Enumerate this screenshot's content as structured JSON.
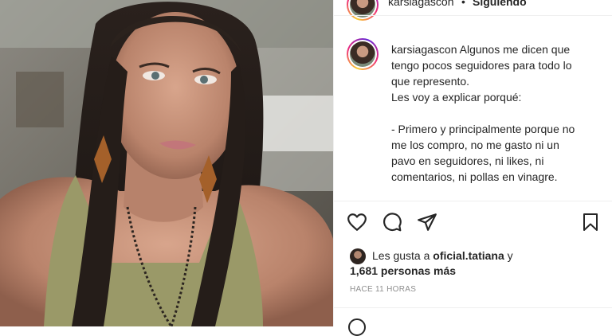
{
  "post": {
    "username": "karsiagascon",
    "separator": "•",
    "follow_status": "Siguiendo",
    "more_icon": "more-horizontal-icon"
  },
  "caption": {
    "username": "karsiagascon",
    "lines": [
      "Algunos me dicen que",
      "tengo pocos seguidores para todo lo",
      "que represento.",
      "Les voy a explicar porqué:",
      "",
      "- Primero y principalmente porque no",
      "me los compro, no me gasto ni un",
      "pavo en seguidores, ni likes, ni",
      "comentarios, ni pollas en vinagre."
    ]
  },
  "actions": {
    "like": "heart-icon",
    "comment": "comment-bubble-icon",
    "share": "paper-plane-icon",
    "save": "bookmark-icon"
  },
  "likes": {
    "prefix": "Les gusta a",
    "user": "oficial.tatiana",
    "connector": "y",
    "count_text": "1,681 personas más"
  },
  "timestamp": "HACE 11 HORAS",
  "colors": {
    "text": "#262626",
    "muted": "#8e8e8e",
    "divider": "#efefef",
    "ring_start": "#f9ce34",
    "ring_mid": "#ee2a7b",
    "ring_end": "#6228d7"
  }
}
